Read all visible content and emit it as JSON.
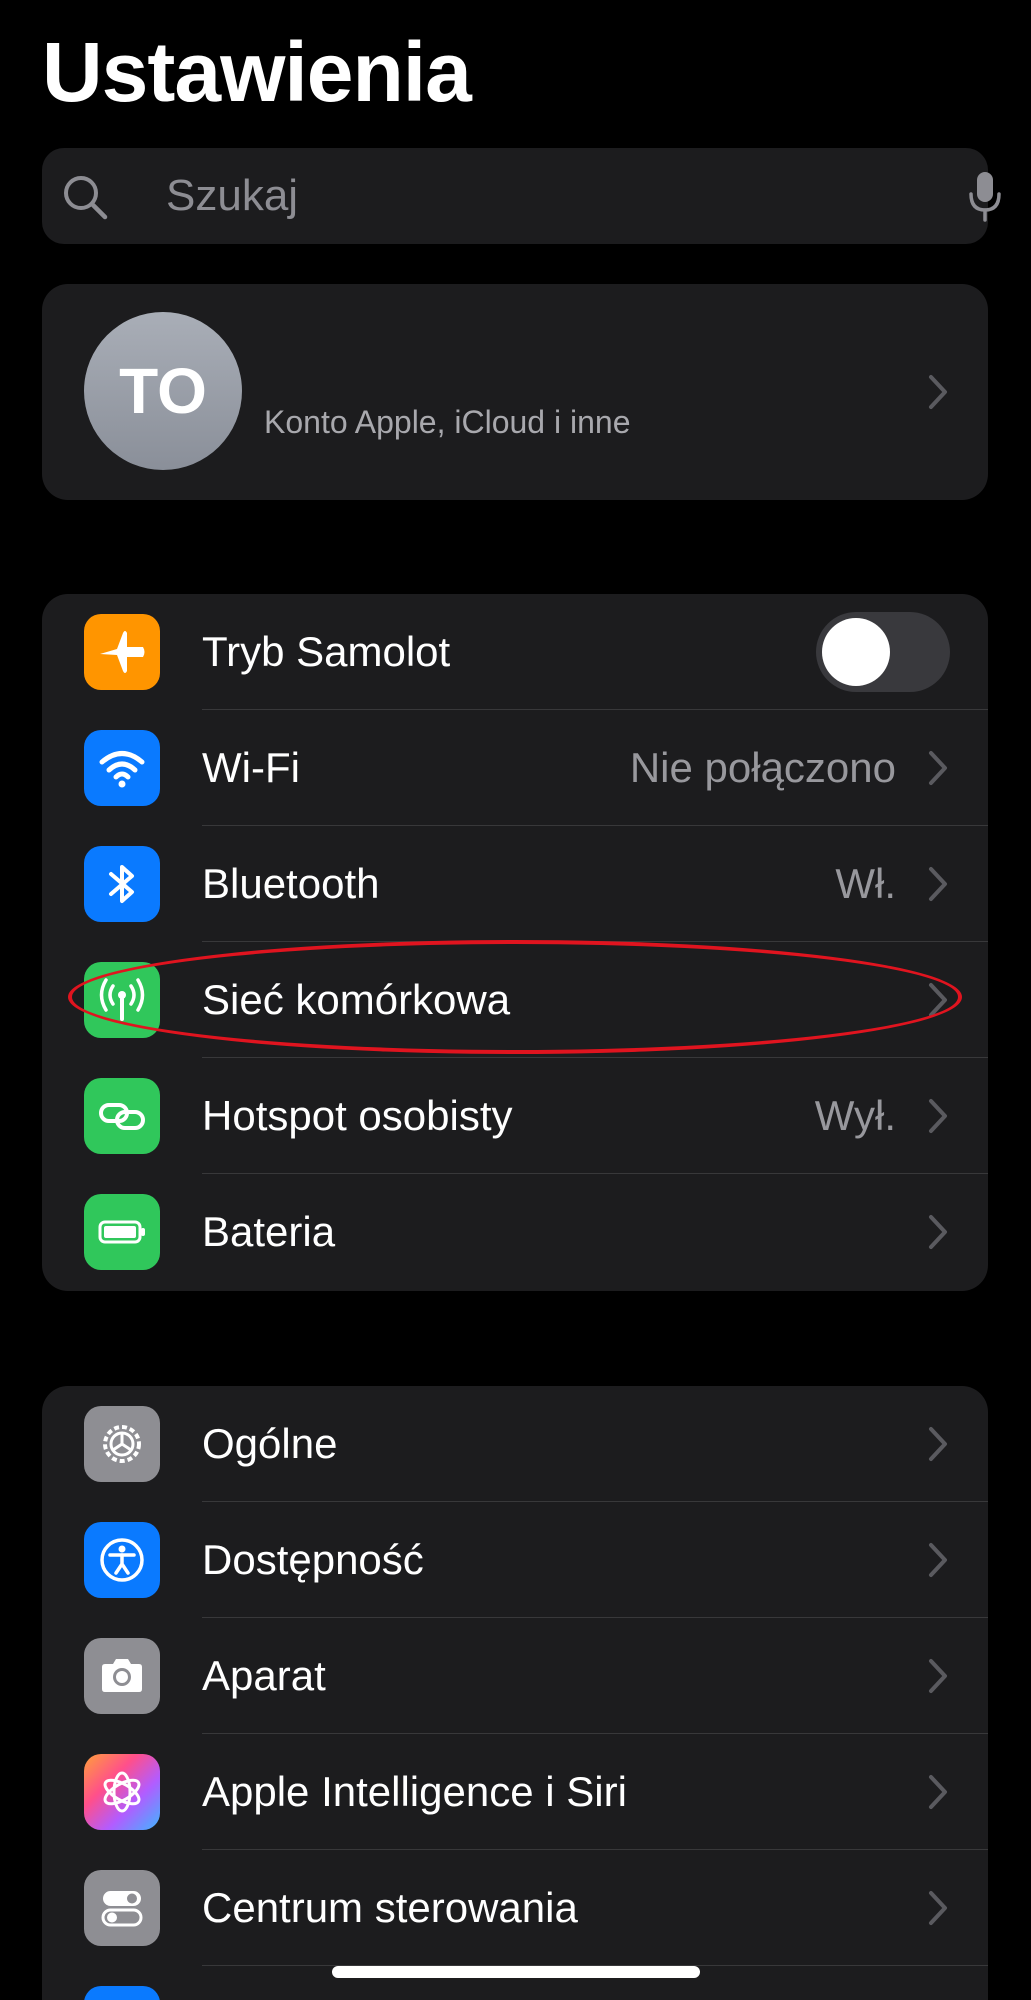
{
  "header": {
    "title": "Ustawienia"
  },
  "search": {
    "placeholder": "Szukaj"
  },
  "profile": {
    "initials": "TO",
    "subtitle": "Konto Apple, iCloud i inne"
  },
  "group1": [
    {
      "label": "Tryb Samolot",
      "icon": "airplane-icon",
      "color": "#ff9500",
      "toggle": false
    },
    {
      "label": "Wi‑Fi",
      "value": "Nie połączono",
      "icon": "wifi-icon",
      "color": "#0a7aff"
    },
    {
      "label": "Bluetooth",
      "value": "Wł.",
      "icon": "bluetooth-icon",
      "color": "#0a7aff"
    },
    {
      "label": "Sieć komórkowa",
      "value": "",
      "icon": "cellular-antenna-icon",
      "color": "#30c75b"
    },
    {
      "label": "Hotspot osobisty",
      "value": "Wył.",
      "icon": "hotspot-link-icon",
      "color": "#30c75b"
    },
    {
      "label": "Bateria",
      "value": "",
      "icon": "battery-icon",
      "color": "#30c75b"
    }
  ],
  "group2": [
    {
      "label": "Ogólne",
      "icon": "gear-icon",
      "color": "#8e8e93"
    },
    {
      "label": "Dostępność",
      "icon": "accessibility-icon",
      "color": "#0a7aff"
    },
    {
      "label": "Aparat",
      "icon": "camera-icon",
      "color": "#8e8e93"
    },
    {
      "label": "Apple Intelligence i Siri",
      "icon": "apple-intelligence-icon",
      "color": "gradient"
    },
    {
      "label": "Centrum sterowania",
      "icon": "control-center-icon",
      "color": "#8e8e93"
    }
  ],
  "colors": {
    "background": "#000000",
    "cell": "#1c1c1e",
    "separator": "#38383a",
    "secondary_text": "#98989d",
    "highlight": "#e0141f"
  }
}
